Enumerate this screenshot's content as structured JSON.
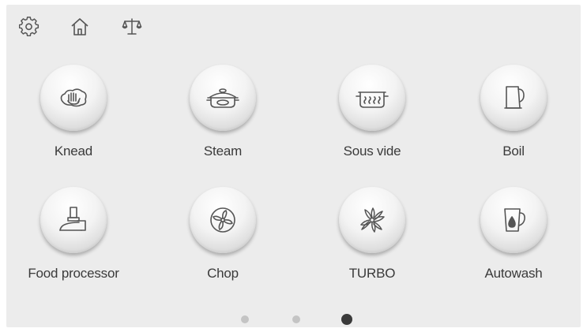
{
  "top_bar": {
    "icons": [
      "gear-icon",
      "home-icon",
      "scale-icon"
    ]
  },
  "programs": [
    {
      "label": "Knead",
      "icon": "hand-icon"
    },
    {
      "label": "Steam",
      "icon": "steamer-pot-icon"
    },
    {
      "label": "Sous vide",
      "icon": "sous-vide-pot-icon"
    },
    {
      "label": "Boil",
      "icon": "kettle-icon"
    },
    {
      "label": "Food processor",
      "icon": "food-processor-icon"
    },
    {
      "label": "Chop",
      "icon": "fan-blade-icon"
    },
    {
      "label": "TURBO",
      "icon": "turbo-blade-icon"
    },
    {
      "label": "Autowash",
      "icon": "jug-drop-icon"
    }
  ],
  "pagination": {
    "pages": 3,
    "active_page": 3
  },
  "colors": {
    "background": "#ececec",
    "icon_stroke": "#555555",
    "label_text": "#3a3a3a",
    "dot_inactive": "#c4c4c4",
    "dot_active": "#3a3a3a"
  }
}
